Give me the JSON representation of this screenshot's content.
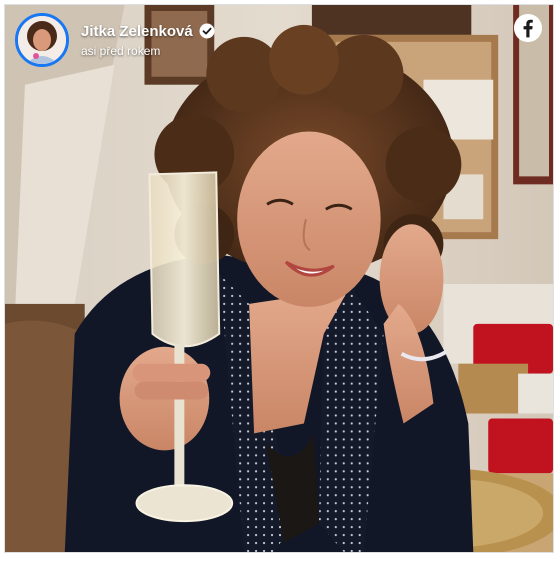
{
  "post": {
    "author_name": "Jitka Zelenková",
    "timestamp": "asi před rokem",
    "verified": true
  },
  "icons": {
    "verified": "verified-check-icon",
    "platform": "facebook-icon"
  },
  "colors": {
    "avatar_ring": "#1877f2",
    "text": "#ffffff"
  }
}
